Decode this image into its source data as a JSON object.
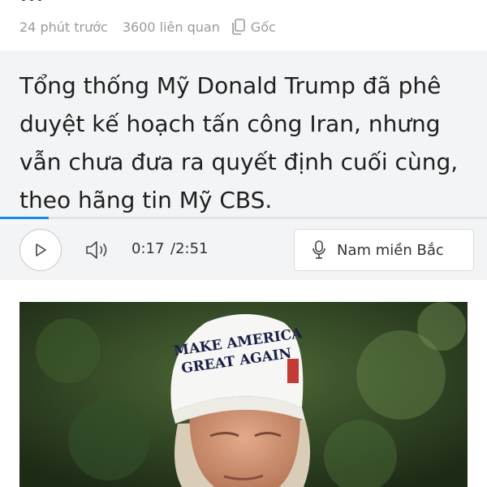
{
  "article": {
    "headline_fragment": "…",
    "meta": {
      "time": "24 phút trước",
      "related": "3600 liên quan",
      "source_label": "Gốc"
    },
    "summary": "Tổng thống Mỹ Donald Trump đã phê duyệt kế hoạch tấn công Iran, nhưng vẫn chưa đưa ra quyết định cuối cùng, theo hãng tin Mỹ CBS.",
    "audio": {
      "current_time": "0:17",
      "total_time": "/2:51",
      "progress_fraction": 0.1,
      "voice": "Nam miền Bắc"
    },
    "photo": {
      "cap_text_line1": "MAKE AMERICA",
      "cap_text_line2": "GREAT AGAIN"
    }
  },
  "colors": {
    "accent": "#1e88e5",
    "panel_bg": "#f3f4f6",
    "meta_text": "#9a9a9a"
  },
  "icons": [
    "copy-icon",
    "play-icon",
    "volume-icon",
    "microphone-icon"
  ]
}
